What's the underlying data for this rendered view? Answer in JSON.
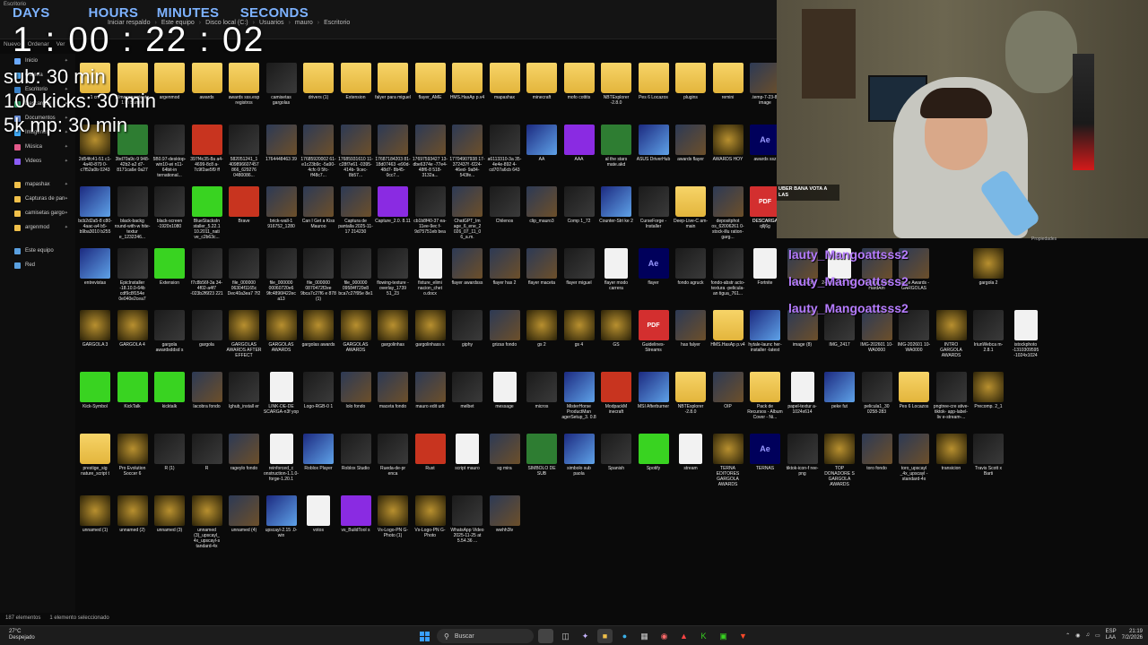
{
  "window": {
    "title": "Escritorio"
  },
  "breadcrumb": [
    "Iniciar respaldo",
    "Este equipo",
    "Disco local (C:)",
    "Usuarios",
    "mauro",
    "Escritorio"
  ],
  "toolbar": {
    "new_label": "Nuevo",
    "sort_label": "Ordenar",
    "view_label": "Ver"
  },
  "timer": {
    "days_label": "DAYS",
    "hours_label": "HOURS",
    "minutes_label": "MINUTES",
    "seconds_label": "SECONDS",
    "value": "1 : 00 :  22 : 02"
  },
  "goals": [
    "sub: 30 min",
    "100 kicks: 30 min",
    "5k mp: 30 min"
  ],
  "sidebar": {
    "items": [
      {
        "label": "Inicio",
        "icon": "home-icon",
        "color": "#6aa9ff"
      },
      {
        "label": "Galería",
        "icon": "gallery-icon",
        "color": "#4aa3e8"
      },
      {
        "label": "Escritorio",
        "icon": "desktop-icon",
        "color": "#3b82c9"
      },
      {
        "label": "Descargas",
        "icon": "download-icon",
        "color": "#36a36a"
      },
      {
        "label": "Documentos",
        "icon": "document-icon",
        "color": "#6b8fd6"
      },
      {
        "label": "Imágenes",
        "icon": "image-icon",
        "color": "#3fa9f5"
      },
      {
        "label": "Música",
        "icon": "music-icon",
        "color": "#e35a8a"
      },
      {
        "label": "Videos",
        "icon": "video-icon",
        "color": "#8b5cf6"
      },
      {
        "label": "mapashax",
        "icon": "folder-icon",
        "color": "#f0c04a"
      },
      {
        "label": "Capturas de pan",
        "icon": "folder-icon",
        "color": "#f0c04a"
      },
      {
        "label": "camisetas gargo",
        "icon": "folder-icon",
        "color": "#f0c04a"
      },
      {
        "label": "argenmod",
        "icon": "folder-icon",
        "color": "#f0c04a"
      },
      {
        "label": "Este equipo",
        "icon": "computer-icon",
        "color": "#5aa0e0"
      },
      {
        "label": "Red",
        "icon": "network-icon",
        "color": "#5aa0e0"
      }
    ]
  },
  "desktop": {
    "rows": [
      [
        {
          "label": "1 cm",
          "kind": "folder"
        },
        {
          "label": "Almacenamiento 1 Pi Summ",
          "kind": "folder"
        },
        {
          "label": "argenmod",
          "kind": "folder"
        },
        {
          "label": "awards",
          "kind": "folder"
        },
        {
          "label": "awards sss.esp registros",
          "kind": "folder"
        },
        {
          "label": "camisetas gargolas",
          "kind": "dark"
        },
        {
          "label": "drivers (1)",
          "kind": "folder"
        },
        {
          "label": "Extension",
          "kind": "folder"
        },
        {
          "label": "falyer para miguel",
          "kind": "folder"
        },
        {
          "label": "flayer_AME",
          "kind": "folder"
        },
        {
          "label": "HMS.HasAp p.v4",
          "kind": "folder"
        },
        {
          "label": "mapashax",
          "kind": "folder"
        },
        {
          "label": "minecraft",
          "kind": "folder"
        },
        {
          "label": "mofo cottits",
          "kind": "folder"
        },
        {
          "label": "NBTExplorer -2.8.0",
          "kind": "folder"
        },
        {
          "label": "Pes 6 Locazos",
          "kind": "folder"
        },
        {
          "label": "plugins",
          "kind": "folder"
        },
        {
          "label": "remini",
          "kind": "folder"
        },
        {
          "label": ".temp-7-23-8-image",
          "kind": "image"
        },
        {
          "label": ".temp-7-23-8-image_u scayl-stand",
          "kind": "image"
        }
      ],
      [
        {
          "label": "2d54fc41-51 c1-4a40-879 0-c7f52a0b 0243",
          "kind": "gold"
        },
        {
          "label": "3bd70a9c-9 948-42b2-a2 d7-8171ca6e 0a27",
          "kind": "mint"
        },
        {
          "label": "5B0.97-desktop-win10-wi n11-64bit-in ternational...",
          "kind": "dark"
        },
        {
          "label": "397f4c35-8a a4-4699-8c8 a-7c9f2ae5f9 ff",
          "kind": "red"
        },
        {
          "label": "582051241_1 409896607457 866_629276 0480086...",
          "kind": "dark"
        },
        {
          "label": "1764448463 39",
          "kind": "image"
        },
        {
          "label": "17685920002 61-e1c23b9c -5a90-4cfc-9 5fc-ff48c7...",
          "kind": "image"
        },
        {
          "label": "17685931610 11-c28f7e61 -0395-414b- 9cec-8b57...",
          "kind": "image"
        },
        {
          "label": "17687184203 81-18d07463 -e90d-48d7- 8b45-0cc7...",
          "kind": "image"
        },
        {
          "label": "17697593427 13-dbe6374e -77e4-48f6-8 518-3132a...",
          "kind": "image"
        },
        {
          "label": "17704907938 17-372437f -f224-46ed- 9a84-543fe...",
          "kind": "image"
        },
        {
          "label": "a6113310-3a 35-4e4e-892 4-cd707a6cb 643",
          "kind": "dark"
        },
        {
          "label": "AA",
          "kind": "app"
        },
        {
          "label": "AAA",
          "kind": "purple"
        },
        {
          "label": "al the stars mate.akd",
          "kind": "mint"
        },
        {
          "label": "ASUS DriverHub",
          "kind": "app"
        },
        {
          "label": "awards flayer",
          "kind": "image"
        },
        {
          "label": "AWARDS HOY",
          "kind": "gold"
        },
        {
          "label": "awards ssz",
          "kind": "ae"
        }
      ],
      [
        {
          "label": "bcb2d2a5-8 c80-4aac-a4 b5-b9ba3010 b255",
          "kind": "app"
        },
        {
          "label": "black-backg round-with-w hite-textur e_1232246...",
          "kind": "dark"
        },
        {
          "label": "black-screen -1920x1080",
          "kind": "dark"
        },
        {
          "label": "BlueStacksIn staller_5.22.1 10.2011_nati ve_c2b63c...",
          "kind": "green"
        },
        {
          "label": "Brave",
          "kind": "red"
        },
        {
          "label": "brick-wall-1 916752_1280",
          "kind": "image"
        },
        {
          "label": "Can I Get a Kiss Mauroo",
          "kind": "image"
        },
        {
          "label": "Captura de pantalla 2025-11-17 214230",
          "kind": "image"
        },
        {
          "label": "Capture_2.0. 8.11",
          "kind": "purple"
        },
        {
          "label": "cb1b8f40-37 ea-11ee-9ec f-9d75751eb bea",
          "kind": "dark"
        },
        {
          "label": "ChatGPT_Im age_6_ene_2 026_07_11_0 6_a.m.",
          "kind": "image"
        },
        {
          "label": "Chilenos",
          "kind": "dark"
        },
        {
          "label": "clip_mauro3",
          "kind": "image"
        },
        {
          "label": "Comp 1_72",
          "kind": "dark"
        },
        {
          "label": "Counter-Stri ke 2",
          "kind": "app"
        },
        {
          "label": "CurseForge - Installer",
          "kind": "dark"
        },
        {
          "label": "Deep-Live-C am-main",
          "kind": "folder"
        },
        {
          "label": "depositphot os_62006261 0-stock-illu ration-garg...",
          "kind": "image"
        },
        {
          "label": "DESCARGA qllj6g",
          "kind": "pdf"
        }
      ],
      [
        {
          "label": "entrevistas",
          "kind": "app"
        },
        {
          "label": "EpicInstaller -18.10.0-64b cdf9c8f154e 0e040e2cea7",
          "kind": "dark"
        },
        {
          "label": "Extension",
          "kind": "green"
        },
        {
          "label": "f7c8b56f-3a 34-4f02-a4f7 -023b2f6f23 221",
          "kind": "dark"
        },
        {
          "label": "file_000000 06304f1165c Dec40a3ea7 7f2",
          "kind": "dark"
        },
        {
          "label": "file_000000 00060720e6 9fc4896f422ec a13",
          "kind": "dark"
        },
        {
          "label": "file_000000 0870472f2ee 9bca7c27f6 e 878 (1)",
          "kind": "dark"
        },
        {
          "label": "file_000000 09584f720e8 bca7c27f95e 8e1",
          "kind": "dark"
        },
        {
          "label": "flowing-texture -overlay_1739 51_23",
          "kind": "dark"
        },
        {
          "label": "fixture_elimi nacion_chet o.docx",
          "kind": "doc"
        },
        {
          "label": "flayer awardsss",
          "kind": "image"
        },
        {
          "label": "flayer has 2",
          "kind": "image"
        },
        {
          "label": "flayer maceta",
          "kind": "image"
        },
        {
          "label": "flayer miguel",
          "kind": "dark"
        },
        {
          "label": "flayer modo carrera",
          "kind": "doc"
        },
        {
          "label": "flayer",
          "kind": "ae"
        },
        {
          "label": "fondo agruck",
          "kind": "dark"
        },
        {
          "label": "fondo-abstr acto-textura -pelicula-an tigua_761...",
          "kind": "dark"
        },
        {
          "label": "Fortnite",
          "kind": "doc"
        }
      ],
      [
        {
          "label": "GARGOLA 3",
          "kind": "gold"
        },
        {
          "label": "GARGOLA 4",
          "kind": "gold"
        },
        {
          "label": "gargola awardsddsd s",
          "kind": "dark"
        },
        {
          "label": "gargola",
          "kind": "dark"
        },
        {
          "label": "GARGOLAS AWARDS AFTER EFFECT",
          "kind": "gold"
        },
        {
          "label": "GARGOLAS AWARDS",
          "kind": "gold"
        },
        {
          "label": "gargolas awards",
          "kind": "gold"
        },
        {
          "label": "GARGOLAS AWARDS",
          "kind": "gold"
        },
        {
          "label": "gargolinhas",
          "kind": "gold"
        },
        {
          "label": "gargolinhass s",
          "kind": "gold"
        },
        {
          "label": "giphy",
          "kind": "dark"
        },
        {
          "label": "grizas fondo",
          "kind": "image"
        },
        {
          "label": "gs 2",
          "kind": "gold"
        },
        {
          "label": "gs 4",
          "kind": "gold"
        },
        {
          "label": "GS",
          "kind": "gold"
        },
        {
          "label": "Guidelines- Streams",
          "kind": "pdf"
        },
        {
          "label": "has falyer",
          "kind": "image"
        },
        {
          "label": "HMS.HasAp p.v4",
          "kind": "folder"
        },
        {
          "label": "hytale-launc her-installer -latest",
          "kind": "app"
        }
      ],
      [
        {
          "label": "Kick-Symbol",
          "kind": "green"
        },
        {
          "label": "KickTalk",
          "kind": "green"
        },
        {
          "label": "kicktalk",
          "kind": "green"
        },
        {
          "label": "lacobra fondo",
          "kind": "image"
        },
        {
          "label": "lghub_install er",
          "kind": "dark"
        },
        {
          "label": "LINK-DE-DE SCARGA-n3f yop",
          "kind": "doc"
        },
        {
          "label": "Logo-RGB-0 1",
          "kind": "dark"
        },
        {
          "label": "lolo fondo",
          "kind": "image"
        },
        {
          "label": "maceta fondo",
          "kind": "image"
        },
        {
          "label": "mauro edit udt",
          "kind": "image"
        },
        {
          "label": "melbet",
          "kind": "dark"
        },
        {
          "label": "message",
          "kind": "doc"
        },
        {
          "label": "micros",
          "kind": "dark"
        },
        {
          "label": "MisterHorse ProductMan agerSetup_3. 0.8",
          "kind": "app"
        },
        {
          "label": "ModpackM inecraft",
          "kind": "red"
        },
        {
          "label": "MSI Afterburner",
          "kind": "app"
        },
        {
          "label": "NBTExplorer -2.8.0",
          "kind": "folder"
        },
        {
          "label": "OIP",
          "kind": "image"
        },
        {
          "label": "Pack de Recursos - Album Cover - Ni...",
          "kind": "folder"
        }
      ],
      [
        {
          "label": "prestige_sig nature_script t",
          "kind": "folder"
        },
        {
          "label": "Pro Evolution Soccer 6",
          "kind": "gold"
        },
        {
          "label": "R (1)",
          "kind": "dark"
        },
        {
          "label": "R",
          "kind": "dark"
        },
        {
          "label": "rageylo fondo",
          "kind": "image"
        },
        {
          "label": "reinforced_c onstruction-1.1.0-forge-1.20.1",
          "kind": "doc"
        },
        {
          "label": "Roblox Player",
          "kind": "app"
        },
        {
          "label": "Roblox Studio",
          "kind": "dark"
        },
        {
          "label": "Rueda-de-pr enca",
          "kind": "dark"
        },
        {
          "label": "Rust",
          "kind": "red"
        },
        {
          "label": "script mauro",
          "kind": "doc"
        },
        {
          "label": "sg mira",
          "kind": "image"
        },
        {
          "label": "SIMBOLO DE SUB",
          "kind": "mint"
        },
        {
          "label": "simbolo sub paola",
          "kind": "app"
        },
        {
          "label": "Spanish",
          "kind": "dark"
        },
        {
          "label": "Spotify",
          "kind": "green"
        },
        {
          "label": "stream",
          "kind": "doc"
        },
        {
          "label": "TERNA EDITORES GARGOLA AWARDS",
          "kind": "gold"
        },
        {
          "label": "TERNAS",
          "kind": "ae"
        }
      ],
      [
        {
          "label": "unnamed (1)",
          "kind": "gold"
        },
        {
          "label": "unnamed (2)",
          "kind": "gold"
        },
        {
          "label": "unnamed (3)",
          "kind": "gold"
        },
        {
          "label": "unnamed (3)_upscayl_ 4x_upscayl-s tandard-4x",
          "kind": "gold"
        },
        {
          "label": "unnamed (4)",
          "kind": "image"
        },
        {
          "label": "upscayl-2.15 .0-win",
          "kind": "app"
        },
        {
          "label": "votos",
          "kind": "doc"
        },
        {
          "label": "vs_BuildTool s",
          "kind": "purple"
        },
        {
          "label": "Vs-Logo-PN G-Photo (1)",
          "kind": "gold"
        },
        {
          "label": "Vs-Logo-PN G-Photo",
          "kind": "gold"
        },
        {
          "label": "WhatsApp Video 2025-11-25 at 5.54.36 ...",
          "kind": "dark"
        },
        {
          "label": "wwhh3lv",
          "kind": "image"
        }
      ]
    ],
    "extra": [
      {
        "label": "DESCARGA",
        "kind": "pdf"
      },
      {
        "label": "Plastic-Text e",
        "kind": "image"
      },
      {
        "label": "2-forge-mc1 .20.1",
        "kind": "doc"
      },
      {
        "label": "Bazinga from HardAm",
        "kind": "image"
      },
      {
        "label": "Touze Awards - GARGOLAS",
        "kind": "image"
      },
      {
        "label": "gargola 2",
        "kind": "gold"
      },
      {
        "label": "image (8)",
        "kind": "image"
      },
      {
        "label": "IMG_2417",
        "kind": "dark"
      },
      {
        "label": "IMG-202601 10-WA0000",
        "kind": "image"
      },
      {
        "label": "IMG-202601 10-WA0000",
        "kind": "dark"
      },
      {
        "label": "INTRO GARGOLA AWARDS",
        "kind": "gold"
      },
      {
        "label": "IriunWebca m-2.8.1",
        "kind": "dark"
      },
      {
        "label": "istockphoto -1310309595 -1024x1024",
        "kind": "doc"
      },
      {
        "label": "papel-textur a-1024x614",
        "kind": "doc"
      },
      {
        "label": "peke fut",
        "kind": "app"
      },
      {
        "label": "pelicula1_30 0258-283",
        "kind": "dark"
      },
      {
        "label": "Pes 6 Locazos",
        "kind": "folder"
      },
      {
        "label": "pngtree-cre ative-tiktok- app-label-liv e-stream-...",
        "kind": "dark"
      },
      {
        "label": "Precomp. 2_1",
        "kind": "gold"
      },
      {
        "label": "tiktok-icon-f ree-png",
        "kind": "dark"
      },
      {
        "label": "TOP DONADORE S GARGOLA AWARDS",
        "kind": "gold"
      },
      {
        "label": "toro fondo",
        "kind": "image"
      },
      {
        "label": "toro_upscayl _4x_upscayl -standard-4x",
        "kind": "image"
      },
      {
        "label": "transicion",
        "kind": "gold"
      },
      {
        "label": "Travis Scott x Barti",
        "kind": "dark"
      }
    ]
  },
  "chat": {
    "line": "lauty_Mangoattsss2"
  },
  "webcam": {
    "banner": "UBER BANA VOTA A LAS",
    "context_label": "Propiedades"
  },
  "statusbar": {
    "count": "187 elementos",
    "selection": "1 elemento seleccionado"
  },
  "taskbar": {
    "weather_temp": "27°C",
    "weather_desc": "Despejado",
    "search_placeholder": "Buscar",
    "lang": "ESP",
    "region": "LAA",
    "time": "21:19",
    "date": "7/2/2026"
  }
}
